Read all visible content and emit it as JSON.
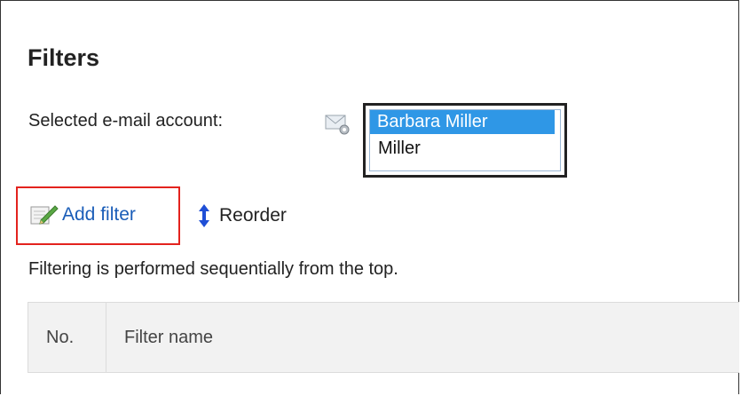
{
  "page": {
    "title": "Filters"
  },
  "account": {
    "label": "Selected e-mail account:",
    "icon": "mail-settings-icon",
    "options": [
      "Barbara Miller",
      "Miller"
    ],
    "selected": "Barbara Miller"
  },
  "actions": {
    "add_filter": "Add filter",
    "reorder": "Reorder"
  },
  "hint": "Filtering is performed sequentially from the top.",
  "table": {
    "columns": [
      "No.",
      "Filter name"
    ]
  },
  "colors": {
    "link": "#1a5db8",
    "highlight": "#e3231e",
    "selected_bg": "#2f97e6"
  }
}
